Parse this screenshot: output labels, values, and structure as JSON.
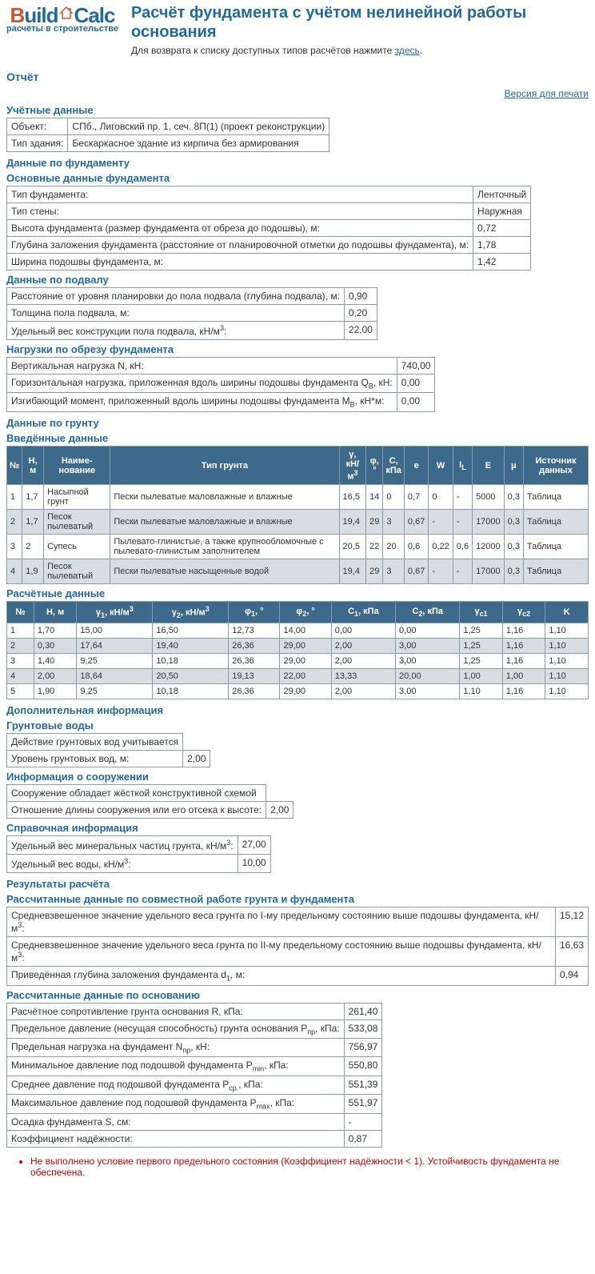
{
  "logo": {
    "b": "B",
    "uild": "uild",
    "calc": "Calc",
    "sub": "расчёты в строительстве"
  },
  "title": "Расчёт фундамента с учётом нелинейной работы основания",
  "subtitle_pre": "Для возврата к списку доступных типов расчётов нажмите ",
  "subtitle_link": "здесь",
  "report_h": "Отчёт",
  "print_link": "Версия для печати",
  "acc_h": "Учётные данные",
  "acc": [
    [
      "Объект:",
      "СПб., Лиговский пр. 1, сеч. 8П(1) (проект реконструкции)"
    ],
    [
      "Тип здания:",
      "Бескаркасное здание из кирпича без армирования"
    ]
  ],
  "found_h": "Данные по фундаменту",
  "found_main_h": "Основные данные фундамента",
  "found_main": [
    [
      "Тип фундамента:",
      "Ленточный"
    ],
    [
      "Тип стены:",
      "Наружная"
    ],
    [
      "Высота фундамента (размер фундамента от обреза до подошвы), м:",
      "0,72"
    ],
    [
      "Глубина заложения фундамента (расстояние от планировочной отметки до подошвы фундамента), м:",
      "1,78"
    ],
    [
      "Ширина подошвы фундамента, м:",
      "1,42"
    ]
  ],
  "basement_h": "Данные по подвалу",
  "basement": [
    [
      "Расстояние от уровня планировки до пола подвала (глубина подвала), м:",
      "0,90"
    ],
    [
      "Толщина пола подвала, м:",
      "0,20"
    ],
    [
      "Удельный вес конструкции пола подвала, кН/м³:",
      "22,00"
    ]
  ],
  "loads_h": "Нагрузки по обрезу фундамента",
  "loads": [
    [
      "Вертикальная нагрузка N, кН:",
      "740,00"
    ],
    [
      "Горизонтальная нагрузка, приложенная вдоль ширины подошвы фундамента Q_B, кН:",
      "0,00"
    ],
    [
      "Изгибающий момент, приложенный вдоль ширины подошвы фундамента M_B, кН*м:",
      "0,00"
    ]
  ],
  "soil_h": "Данные по грунту",
  "soil_in_h": "Введённые данные",
  "soil_head": [
    "№",
    "H, м",
    "Наиме-нование",
    "Тип грунта",
    "γ, кН/м³",
    "φ, °",
    "C, кПа",
    "e",
    "W",
    "I_L",
    "E",
    "μ",
    "Источник данных"
  ],
  "soil_rows": [
    [
      "1",
      "1,7",
      "Насыпной грунт",
      "Пески пылеватые маловлажные и влажные",
      "16,5",
      "14",
      "0",
      "0,7",
      "0",
      "-",
      "5000",
      "0,3",
      "Таблица"
    ],
    [
      "2",
      "1,7",
      "Песок пылеватый",
      "Пески пылеватые маловлажные и влажные",
      "19,4",
      "29",
      "3",
      "0,67",
      "-",
      "-",
      "17000",
      "0,3",
      "Таблица"
    ],
    [
      "3",
      "2",
      "Супесь",
      "Пылевато-глинистые, а также крупнообломочные с пылевато-глинистым заполнителем",
      "20,5",
      "22",
      "20",
      "0,6",
      "0,22",
      "0,6",
      "12000",
      "0,3",
      "Таблица"
    ],
    [
      "4",
      "1,9",
      "Песок пылеватый",
      "Пески пылеватые насыщенные водой",
      "19,4",
      "29",
      "3",
      "0,67",
      "-",
      "-",
      "17000",
      "0,3",
      "Таблица"
    ]
  ],
  "calc_h": "Расчётные данные",
  "calc_head": [
    "№",
    "H, м",
    "γ₁, кН/м³",
    "γ₂, кН/м³",
    "φ₁, °",
    "φ₂, °",
    "C₁, кПа",
    "C₂, кПа",
    "γc1",
    "γc2",
    "K"
  ],
  "calc_rows": [
    [
      "1",
      "1,70",
      "15,00",
      "16,50",
      "12,73",
      "14,00",
      "0,00",
      "0,00",
      "1,25",
      "1,16",
      "1,10"
    ],
    [
      "2",
      "0,30",
      "17,64",
      "19,40",
      "26,36",
      "29,00",
      "2,00",
      "3,00",
      "1,25",
      "1,16",
      "1,10"
    ],
    [
      "3",
      "1,40",
      "9,25",
      "10,18",
      "26,36",
      "29,00",
      "2,00",
      "3,00",
      "1,25",
      "1,16",
      "1,10"
    ],
    [
      "4",
      "2,00",
      "18,64",
      "20,50",
      "19,13",
      "22,00",
      "13,33",
      "20,00",
      "1,00",
      "1,00",
      "1,10"
    ],
    [
      "5",
      "1,90",
      "9,25",
      "10,18",
      "26,36",
      "29,00",
      "2,00",
      "3,00",
      "1,10",
      "1,16",
      "1,10"
    ]
  ],
  "extra_h": "Дополнительная информация",
  "gw_h": "Грунтовые воды",
  "gw": [
    [
      "Действие грунтовых вод учитывается",
      ""
    ],
    [
      "Уровень грунтовых вод, м:",
      "2,00"
    ]
  ],
  "struct_h": "Информация о сооружении",
  "struct": [
    [
      "Сооружение обладает жёсткой конструктивной схемой",
      ""
    ],
    [
      "Отношение длины сооружения или его отсека к высоте:",
      "2,00"
    ]
  ],
  "ref_h": "Справочная информация",
  "ref": [
    [
      "Удельный вес минеральных частиц грунта, кН/м³:",
      "27,00"
    ],
    [
      "Удельный вес воды, кН/м³:",
      "10,00"
    ]
  ],
  "res_h": "Результаты расчёта",
  "joint_h": "Рассчитанные данные по совместной работе грунта и фундамента",
  "joint": [
    [
      "Средневзвешенное значение удельного веса грунта по I-му предельному состоянию выше подошвы фундамента, кН/м³:",
      "15,12"
    ],
    [
      "Средневзвешенное значение удельного веса грунта по II-му предельному состоянию выше подошвы фундамента, кН/м³:",
      "16,63"
    ],
    [
      "Приведённая глубина заложения фундамента d₁, м:",
      "0,94"
    ]
  ],
  "base_h": "Рассчитанные данные по основанию",
  "base": [
    [
      "Расчётное сопротивление грунта основания R, кПа:",
      "261,40"
    ],
    [
      "Предельное давление (несущая способность) грунта основания P_пр, кПа:",
      "533,08"
    ],
    [
      "Предельная нагрузка на фундамент N_пр, кН:",
      "756,97"
    ],
    [
      "Минимальное давление под подошвой фундамента P_min, кПа:",
      "550,80"
    ],
    [
      "Среднее давление под подошвой фундамента P_ср., кПа:",
      "551,39"
    ],
    [
      "Максимальное давление под подошвой фундамента P_max, кПа:",
      "551,97"
    ],
    [
      "Осадка фундамента S, см:",
      "-"
    ],
    [
      "Коэффициент надёжности:",
      "0,87"
    ]
  ],
  "warn": [
    "Не выполнено условие первого предельного состояния (Коэффициент надёжности < 1). Устойчивость фундамента не обеспечена."
  ]
}
